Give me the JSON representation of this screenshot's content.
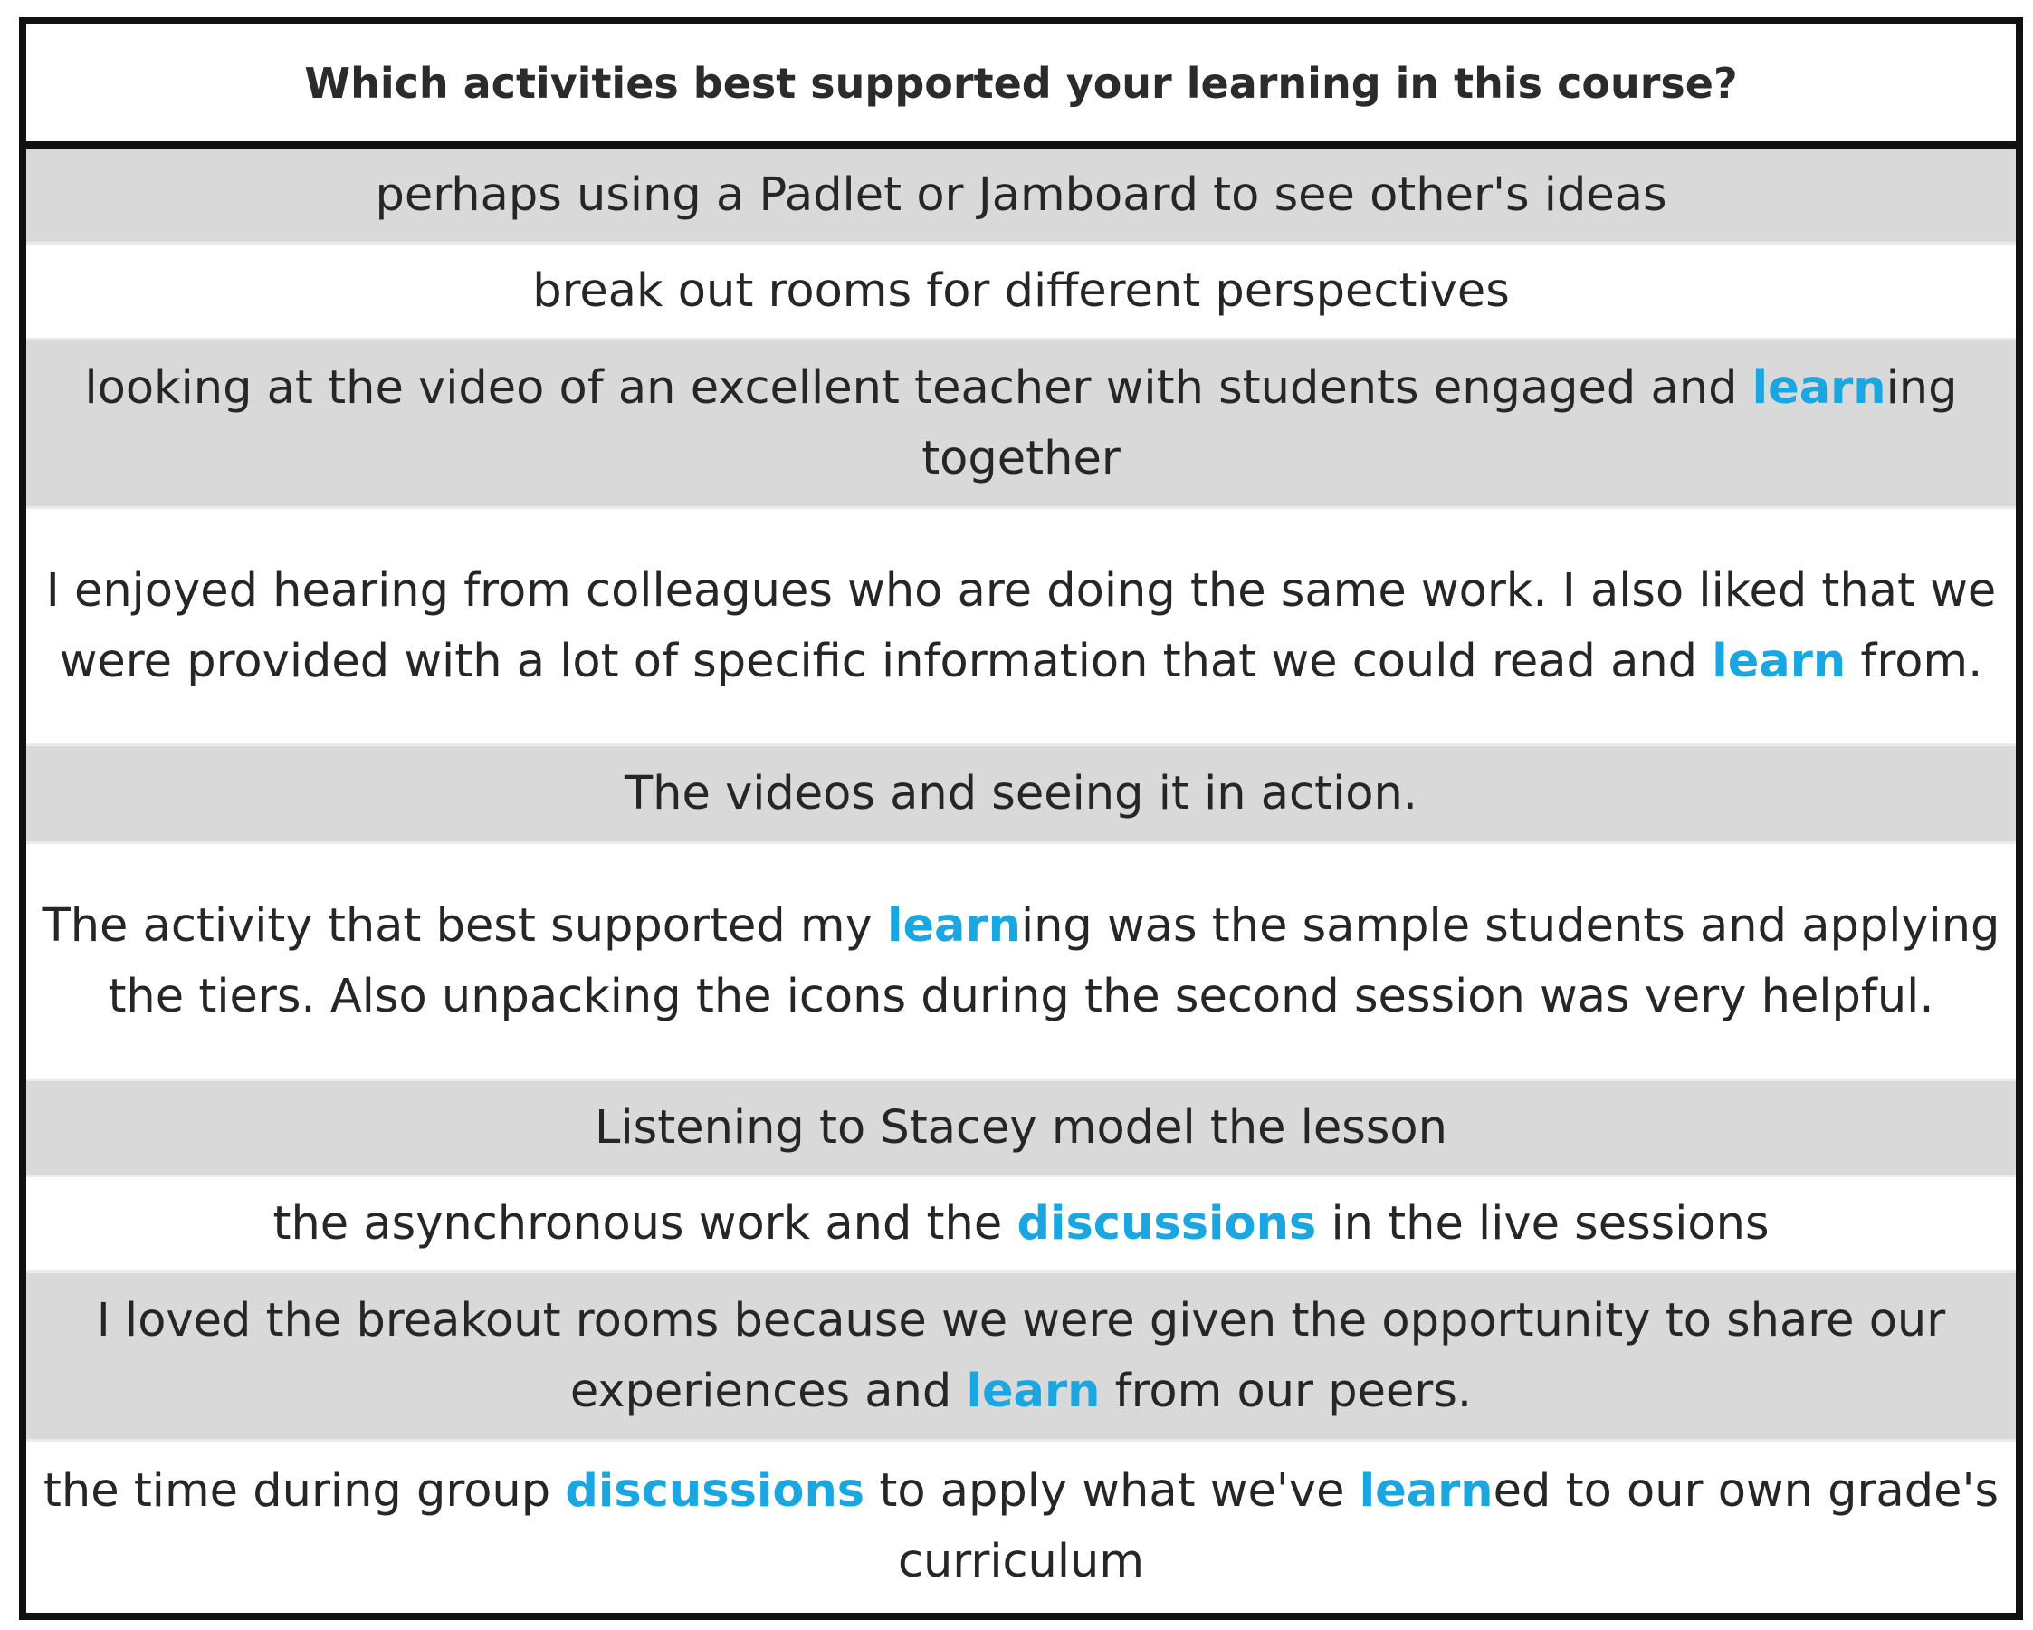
{
  "header": {
    "question": "Which activities best supported your learning in this course?"
  },
  "colors": {
    "highlight": "#1aa6e0",
    "shaded_row": "#d9d9d9",
    "border": "#111111"
  },
  "responses": [
    {
      "segments": [
        {
          "text": "perhaps using a Padlet or Jamboard to see other's ideas"
        }
      ]
    },
    {
      "segments": [
        {
          "text": "break out rooms for different perspectives"
        }
      ]
    },
    {
      "segments": [
        {
          "text": "looking at the video of an excellent teacher with students engaged and "
        },
        {
          "text": "learn",
          "highlight": true
        },
        {
          "text": "ing together"
        }
      ]
    },
    {
      "segments": [
        {
          "text": "I enjoyed hearing from colleagues who are doing the same work. I also liked that we were provided with a lot of specific information that we could read and "
        },
        {
          "text": "learn",
          "highlight": true
        },
        {
          "text": " from."
        }
      ]
    },
    {
      "segments": [
        {
          "text": "The videos and seeing it in action."
        }
      ]
    },
    {
      "segments": [
        {
          "text": "The activity that best supported my "
        },
        {
          "text": "learn",
          "highlight": true
        },
        {
          "text": "ing was the sample students and applying the tiers. Also unpacking the icons during the second session was very helpful."
        }
      ]
    },
    {
      "segments": [
        {
          "text": "Listening to Stacey model the lesson"
        }
      ]
    },
    {
      "segments": [
        {
          "text": "the asynchronous work and the "
        },
        {
          "text": "discussions",
          "highlight": true
        },
        {
          "text": " in the live sessions"
        }
      ]
    },
    {
      "segments": [
        {
          "text": "I loved the breakout rooms because we were given the opportunity to share our experiences and "
        },
        {
          "text": "learn",
          "highlight": true
        },
        {
          "text": " from our peers."
        }
      ]
    },
    {
      "segments": [
        {
          "text": "the time during group "
        },
        {
          "text": "discussions",
          "highlight": true
        },
        {
          "text": " to apply what we've "
        },
        {
          "text": "learn",
          "highlight": true
        },
        {
          "text": "ed to our own grade's curriculum"
        }
      ]
    }
  ]
}
